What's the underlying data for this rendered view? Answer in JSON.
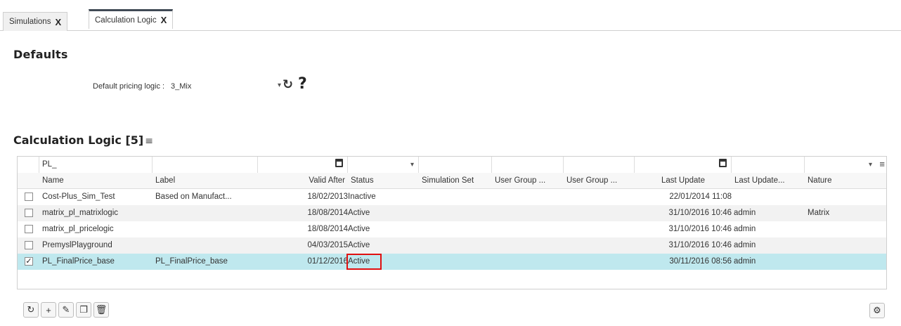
{
  "tabs": [
    {
      "label": "Simulations",
      "close": "X"
    },
    {
      "label": "Calculation Logic",
      "close": "X"
    }
  ],
  "defaults": {
    "title": "Defaults",
    "pricing_logic_label": "Default pricing logic :",
    "pricing_logic_value": "3_Mix",
    "refresh_icon": "↻",
    "help_icon": "?"
  },
  "calc_logic": {
    "title": "Calculation Logic [5]",
    "filter_icon": "≡",
    "filter_value": "PL_",
    "columns": [
      "Name",
      "Label",
      "Valid After",
      "Status",
      "Simulation Set",
      "User Group ...",
      "User Group ...",
      "Last Update",
      "Last Update...",
      "Nature"
    ],
    "rows": [
      {
        "checked": false,
        "name": "Cost-Plus_Sim_Test",
        "label": "Based on Manufact...",
        "valid_after": "18/02/2013",
        "status": "Inactive",
        "sim_set": "",
        "ug1": "",
        "ug2": "",
        "last_update": "22/01/2014 11:08",
        "last_update_by": "",
        "nature": ""
      },
      {
        "checked": false,
        "name": "matrix_pl_matrixlogic",
        "label": "",
        "valid_after": "18/08/2014",
        "status": "Active",
        "sim_set": "",
        "ug1": "",
        "ug2": "",
        "last_update": "31/10/2016 10:46",
        "last_update_by": "admin",
        "nature": "Matrix"
      },
      {
        "checked": false,
        "name": "matrix_pl_pricelogic",
        "label": "",
        "valid_after": "18/08/2014",
        "status": "Active",
        "sim_set": "",
        "ug1": "",
        "ug2": "",
        "last_update": "31/10/2016 10:46",
        "last_update_by": "admin",
        "nature": ""
      },
      {
        "checked": false,
        "name": "PremyslPlayground",
        "label": "",
        "valid_after": "04/03/2015",
        "status": "Active",
        "sim_set": "",
        "ug1": "",
        "ug2": "",
        "last_update": "31/10/2016 10:46",
        "last_update_by": "admin",
        "nature": ""
      },
      {
        "checked": true,
        "name": "PL_FinalPrice_base",
        "label": "PL_FinalPrice_base",
        "valid_after": "01/12/2016",
        "status": "Active",
        "sim_set": "",
        "ug1": "",
        "ug2": "",
        "last_update": "30/11/2016 08:56",
        "last_update_by": "admin",
        "nature": ""
      }
    ]
  },
  "toolbar": {
    "refresh": "↻",
    "add": "+",
    "edit": "✎",
    "copy": "❐",
    "delete": "🗑",
    "settings": "⚙"
  }
}
